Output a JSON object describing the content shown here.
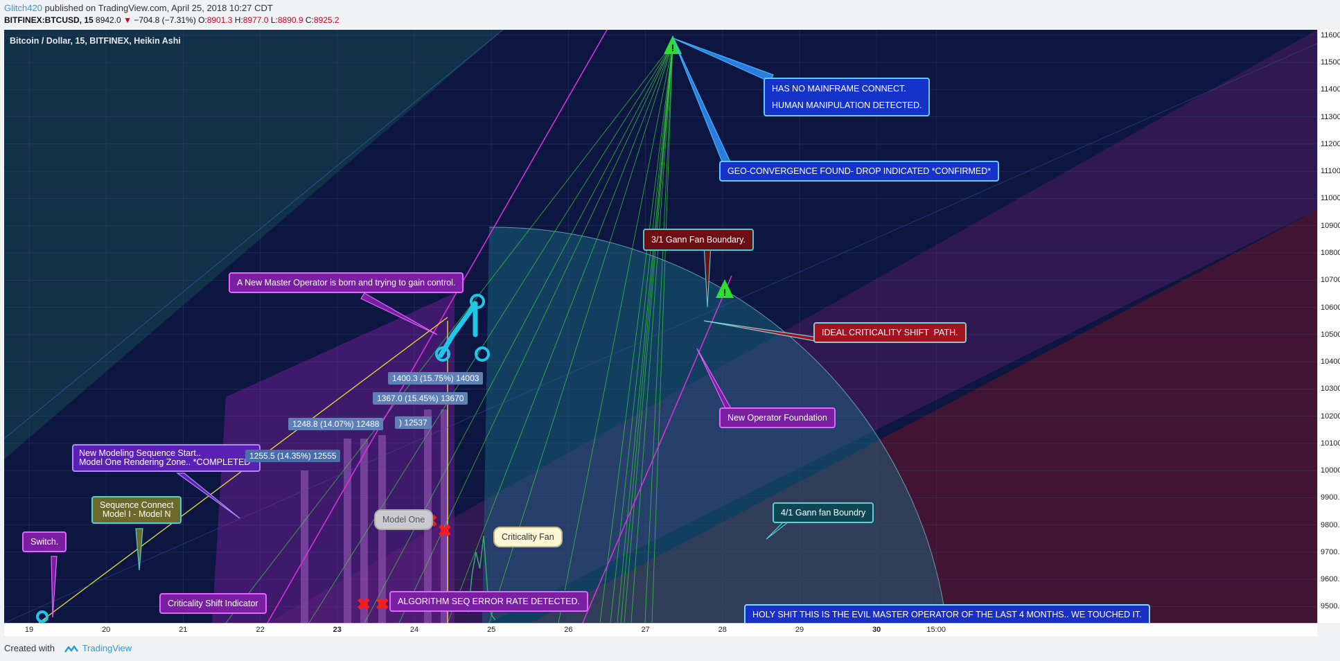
{
  "header": {
    "user": "Glitch420",
    "published": " published on TradingView.com, April 25, 2018 10:27 CDT",
    "symbol": "BITFINEX:BTCUSD, 15",
    "price": "8942.0",
    "change": "−704.8 (−7.31%)",
    "o_label": "O:",
    "o": "8901.3",
    "h_label": "H:",
    "h": "8977.0",
    "l_label": "L:",
    "l": "8890.9",
    "c_label": "C:",
    "c": "8925.2"
  },
  "legend": "Bitcoin / Dollar, 15, BITFINEX, Heikin Ashi",
  "footer": {
    "created": "Created with",
    "brand": "TradingView"
  },
  "colors": {
    "plot_bg": "#0c1640",
    "gann_teal": "#0f3d4c",
    "gann_purple": "#3b1a55",
    "gann_red": "#4a1425",
    "arc": "#2a6f8c",
    "magenta": "#e030e0",
    "green": "#38d838",
    "yellow": "#e8e030",
    "cyan": "#20c8e8",
    "bars": "#8f54b0"
  },
  "callouts": {
    "mainframe": "HAS NO MAINFRAME CONNECT.\n\nHUMAN MANIPULATION DETECTED.",
    "geo": "GEO-CONVERGENCE FOUND- DROP INDICATED *CONFIRMED*",
    "gann31": "3/1 Gann Fan Boundary.",
    "ideal": "IDEAL CRITICALITY SHIFT  PATH.",
    "master": "A New Master Operator is born and trying to gain control.",
    "foundation": "New Operator Foundation",
    "modeling": "New Modeling Sequence Start..\nModel One Rendering Zone.. *COMPLETED*",
    "sequence": "Sequence Connect\nModel I - Model N",
    "switch": "Switch.",
    "shift": "Criticality Shift Indicator",
    "modelone": "Model One",
    "fan": "Criticality Fan",
    "gann41": "4/1 Gann fan Boundry",
    "algo": "ALGORITHM SEQ ERROR RATE DETECTED.",
    "holy": "HOLY SHIT THIS IS THE EVIL MASTER OPERATOR OF THE LAST 4 MONTHS.. WE TOUCHED IT."
  },
  "measures": [
    "1400.3 (15.75%) 14003",
    "1367.0 (15.45%) 13670",
    "1248.8 (14.07%) 12488",
    ") 12537",
    "1255.5 (14.35%) 12555"
  ],
  "chart_data": {
    "type": "line",
    "title": "",
    "xlabel": "",
    "ylabel": "",
    "scale": "linear",
    "ylim": [
      9440,
      11620
    ],
    "grid": true,
    "x_ticks": [
      "19",
      "20",
      "21",
      "22",
      "23",
      "24",
      "25",
      "26",
      "27",
      "28",
      "29",
      "30",
      "15:00"
    ],
    "bold_x_ticks": [
      "23",
      "30"
    ],
    "y_ticks": [
      9500,
      9600,
      9700,
      9800,
      9900,
      10000,
      10100,
      10200,
      10300,
      10400,
      10500,
      10600,
      10700,
      10800,
      10900,
      11000,
      11100,
      11200,
      11300,
      11400,
      11500,
      11600
    ],
    "y_tick_labels": [
      "9500.0",
      "9600.0",
      "9700.0",
      "9800.0",
      "9900.0",
      "10000.0",
      "10100.0",
      "10200.0",
      "10300.0",
      "10400.0",
      "10500.0",
      "10600.0",
      "10700.0",
      "10800.0",
      "10900.0",
      "11000.0",
      "11100.0",
      "11200.0",
      "11300.0",
      "11400.0",
      "11500.0",
      "11600.0"
    ],
    "series": [
      {
        "x": [
          24.7,
          24.75,
          24.8,
          24.85,
          24.9,
          24.95,
          25.0,
          25.05
        ],
        "values": [
          9480,
          9620,
          9700,
          9640,
          9760,
          9560,
          9470,
          9450
        ]
      }
    ]
  }
}
